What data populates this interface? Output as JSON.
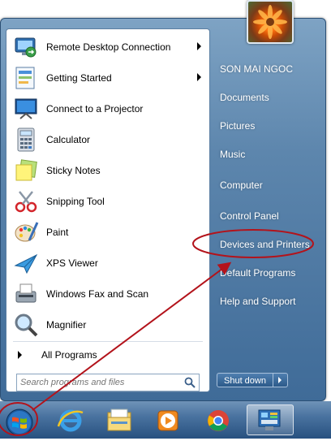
{
  "left_programs": [
    {
      "label": "Remote Desktop Connection",
      "icon": "remote-desktop-icon",
      "submenu": true
    },
    {
      "label": "Getting Started",
      "icon": "getting-started-icon",
      "submenu": true
    },
    {
      "label": "Connect to a Projector",
      "icon": "projector-icon",
      "submenu": false
    },
    {
      "label": "Calculator",
      "icon": "calculator-icon",
      "submenu": false
    },
    {
      "label": "Sticky Notes",
      "icon": "sticky-notes-icon",
      "submenu": false
    },
    {
      "label": "Snipping Tool",
      "icon": "scissors-icon",
      "submenu": false
    },
    {
      "label": "Paint",
      "icon": "paint-palette-icon",
      "submenu": false
    },
    {
      "label": "XPS Viewer",
      "icon": "xps-viewer-icon",
      "submenu": false
    },
    {
      "label": "Windows Fax and Scan",
      "icon": "fax-icon",
      "submenu": false
    },
    {
      "label": "Magnifier",
      "icon": "magnifier-icon",
      "submenu": false
    }
  ],
  "all_programs_label": "All Programs",
  "search": {
    "placeholder": "Search programs and files"
  },
  "right_items": [
    {
      "label": "SON MAI NGOC"
    },
    {
      "label": "Documents"
    },
    {
      "label": "Pictures"
    },
    {
      "label": "Music"
    },
    {
      "label": "Computer"
    },
    {
      "label": "Control Panel"
    },
    {
      "label": "Devices and Printers"
    },
    {
      "label": "Default Programs"
    },
    {
      "label": "Help and Support"
    }
  ],
  "shutdown_label": "Shut down",
  "taskbar": [
    "start-orb-icon",
    "internet-explorer-icon",
    "file-explorer-icon",
    "media-player-icon",
    "chrome-icon",
    "control-panel-icon"
  ],
  "colors": {
    "annotation_red": "#b3131b"
  }
}
